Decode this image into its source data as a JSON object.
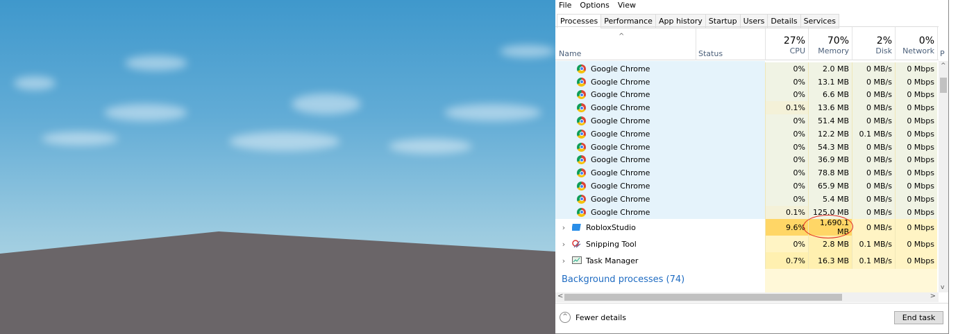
{
  "menu": [
    "File",
    "Options",
    "View"
  ],
  "tabs": [
    "Processes",
    "Performance",
    "App history",
    "Startup",
    "Users",
    "Details",
    "Services"
  ],
  "header": {
    "name": "Name",
    "status": "Status",
    "cpu": {
      "pct": "27%",
      "label": "CPU"
    },
    "memory": {
      "pct": "70%",
      "label": "Memory"
    },
    "disk": {
      "pct": "2%",
      "label": "Disk"
    },
    "network": {
      "pct": "0%",
      "label": "Network"
    },
    "partial": "P"
  },
  "chrome_rows": [
    {
      "name": "Google Chrome",
      "cpu": "0%",
      "mem": "2.0 MB",
      "disk": "0 MB/s",
      "net": "0 Mbps"
    },
    {
      "name": "Google Chrome",
      "cpu": "0%",
      "mem": "13.1 MB",
      "disk": "0 MB/s",
      "net": "0 Mbps"
    },
    {
      "name": "Google Chrome",
      "cpu": "0%",
      "mem": "6.6 MB",
      "disk": "0 MB/s",
      "net": "0 Mbps"
    },
    {
      "name": "Google Chrome",
      "cpu": "0.1%",
      "mem": "13.6 MB",
      "disk": "0 MB/s",
      "net": "0 Mbps"
    },
    {
      "name": "Google Chrome",
      "cpu": "0%",
      "mem": "51.4 MB",
      "disk": "0 MB/s",
      "net": "0 Mbps"
    },
    {
      "name": "Google Chrome",
      "cpu": "0%",
      "mem": "12.2 MB",
      "disk": "0.1 MB/s",
      "net": "0 Mbps"
    },
    {
      "name": "Google Chrome",
      "cpu": "0%",
      "mem": "54.3 MB",
      "disk": "0 MB/s",
      "net": "0 Mbps"
    },
    {
      "name": "Google Chrome",
      "cpu": "0%",
      "mem": "36.9 MB",
      "disk": "0 MB/s",
      "net": "0 Mbps"
    },
    {
      "name": "Google Chrome",
      "cpu": "0%",
      "mem": "78.8 MB",
      "disk": "0 MB/s",
      "net": "0 Mbps"
    },
    {
      "name": "Google Chrome",
      "cpu": "0%",
      "mem": "65.9 MB",
      "disk": "0 MB/s",
      "net": "0 Mbps"
    },
    {
      "name": "Google Chrome",
      "cpu": "0%",
      "mem": "5.4 MB",
      "disk": "0 MB/s",
      "net": "0 Mbps"
    },
    {
      "name": "Google Chrome",
      "cpu": "0.1%",
      "mem": "125.0 MB",
      "disk": "0 MB/s",
      "net": "0 Mbps"
    }
  ],
  "apps": [
    {
      "name": "RobloxStudio",
      "cpu": "9.6%",
      "mem": "1,690.1 MB",
      "disk": "0 MB/s",
      "net": "0 Mbps",
      "icon": "roblox-studio-icon"
    },
    {
      "name": "Snipping Tool",
      "cpu": "0%",
      "mem": "2.8 MB",
      "disk": "0.1 MB/s",
      "net": "0 Mbps",
      "icon": "snipping-tool-icon"
    },
    {
      "name": "Task Manager",
      "cpu": "0.7%",
      "mem": "16.3 MB",
      "disk": "0.1 MB/s",
      "net": "0 Mbps",
      "icon": "task-manager-icon"
    }
  ],
  "background_processes": "Background processes (74)",
  "footer": {
    "fewer_details": "Fewer details",
    "end_task": "End task"
  },
  "colors": {
    "annotation": "#e0231d",
    "heat_high": "#ffd666",
    "heat_low": "#fff4c4",
    "selected_bg": "#e5f3fb"
  }
}
